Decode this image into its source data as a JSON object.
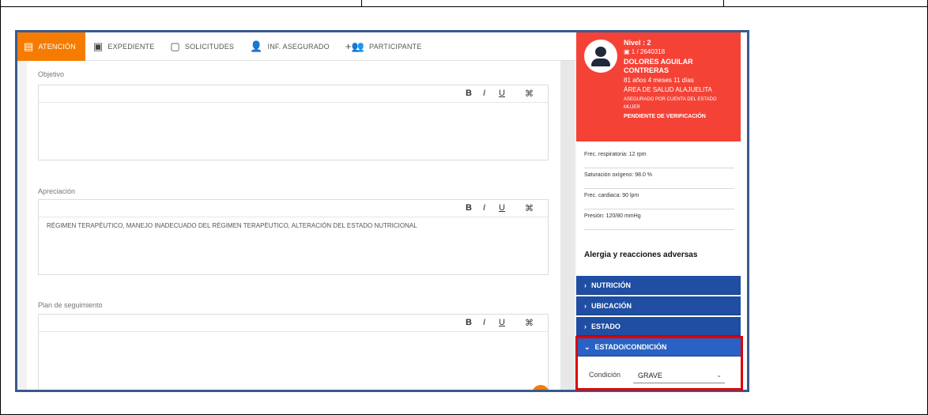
{
  "tabs": [
    {
      "label": "ATENCIÓN",
      "icon": "form-icon",
      "active": true
    },
    {
      "label": "EXPEDIENTE",
      "icon": "folder-icon",
      "active": false
    },
    {
      "label": "SOLICITUDES",
      "icon": "window-icon",
      "active": false
    },
    {
      "label": "INF. ASEGURADO",
      "icon": "person-icon",
      "active": false
    },
    {
      "label": "PARTICIPANTE",
      "icon": "add-group-icon",
      "active": false
    }
  ],
  "sections": {
    "objetivo": {
      "label": "Objetivo",
      "text": ""
    },
    "apreciacion": {
      "label": "Apreciación",
      "text": "RÉGIMEN TERAPÉUTICO, MANEJO INADECUADO DEL RÉGIMEN TERAPÉUTICO, ALTERACIÓN DEL ESTADO NUTRICIONAL"
    },
    "plan": {
      "label": "Plan de seguimiento",
      "text": ""
    }
  },
  "editor_toolbar": {
    "bold": "B",
    "italic": "I",
    "underline": "U",
    "clear": "⌘"
  },
  "patient": {
    "nivel": "Nivel : 2",
    "id": "1 / 2640318",
    "name_line1": "DOLORES AGUILAR",
    "name_line2": "CONTRERAS",
    "age": "81 años 4 meses 11 días",
    "area": "ÁREA DE SALUD ALAJUELITA",
    "coverage": "ASEGURADO POR CUENTA DEL ESTADO",
    "sex": "MUJER",
    "status": "PENDIENTE DE VERIFICACIÓN"
  },
  "vitals": [
    "Frec. respiratoria: 12 rpm",
    "Saturación oxígeno: 98.0 %",
    "Frec. cardiaca: 90 lpm",
    "Presión: 120/80 mmHg"
  ],
  "allergy_title": "Alergia y reacciones adversas",
  "accordion": [
    {
      "label": "NUTRICIÓN",
      "open": false
    },
    {
      "label": "UBICACIÓN",
      "open": false
    },
    {
      "label": "ESTADO",
      "open": false
    },
    {
      "label": "ESTADO/CONDICIÓN",
      "open": true
    }
  ],
  "condition": {
    "label": "Condición",
    "value": "GRAVE"
  },
  "colors": {
    "accent": "#f57c00",
    "patient_card": "#f44336",
    "accordion": "#1f4ea3",
    "highlight": "#e00000"
  }
}
